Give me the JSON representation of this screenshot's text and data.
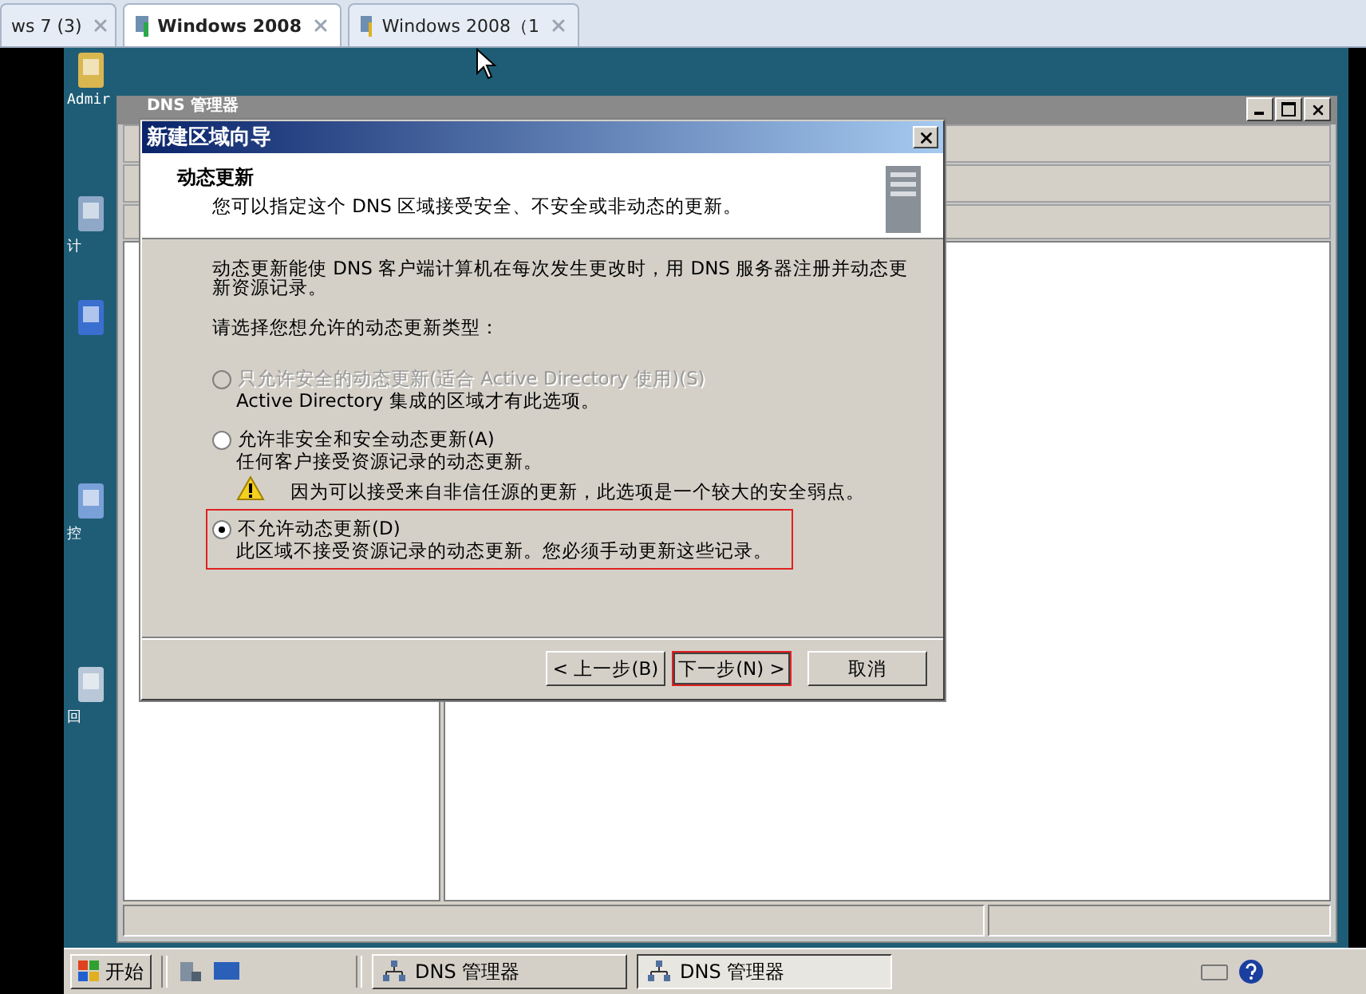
{
  "vm_tabs": [
    {
      "label": "ws 7 (3)",
      "selected": false,
      "kind": "plain"
    },
    {
      "label": "Windows 2008",
      "selected": true,
      "kind": "running"
    },
    {
      "label": "Windows 2008（1",
      "selected": false,
      "kind": "paused"
    }
  ],
  "desktop_icons": [
    {
      "kind": "folder",
      "label": "Admir"
    },
    {
      "kind": "computer",
      "label": "计"
    },
    {
      "kind": "network"
    },
    {
      "kind": "control",
      "label": "控"
    },
    {
      "kind": "recycle",
      "label": "回"
    }
  ],
  "dns_window": {
    "title": "DNS 管理器"
  },
  "wizard": {
    "title": "新建区域向导",
    "heading": "动态更新",
    "subtitle": "您可以指定这个 DNS 区域接受安全、不安全或非动态的更新。",
    "description": "动态更新能使 DNS 客户端计算机在每次发生更改时，用 DNS 服务器注册并动态更新资源记录。",
    "prompt": "请选择您想允许的动态更新类型：",
    "options": [
      {
        "label": "只允许安全的动态更新(适合 Active Directory 使用)(S)",
        "note": "Active Directory 集成的区域才有此选项。",
        "selected": false,
        "disabled": true,
        "highlighted": false
      },
      {
        "label": "允许非安全和安全动态更新(A)",
        "note": "任何客户接受资源记录的动态更新。",
        "warning": "因为可以接受来自非信任源的更新，此选项是一个较大的安全弱点。",
        "selected": false,
        "disabled": false,
        "highlighted": false
      },
      {
        "label": "不允许动态更新(D)",
        "note": "此区域不接受资源记录的动态更新。您必须手动更新这些记录。",
        "selected": true,
        "disabled": false,
        "highlighted": true
      }
    ],
    "buttons": [
      {
        "label": "< 上一步(B)",
        "highlighted": false
      },
      {
        "label": "下一步(N) >",
        "highlighted": true
      },
      {
        "label": "取消",
        "highlighted": false
      }
    ]
  },
  "taskbar": {
    "start": "开始",
    "tasks": [
      {
        "label": "DNS 管理器",
        "selected": false
      },
      {
        "label": "DNS 管理器",
        "selected": true
      }
    ]
  }
}
